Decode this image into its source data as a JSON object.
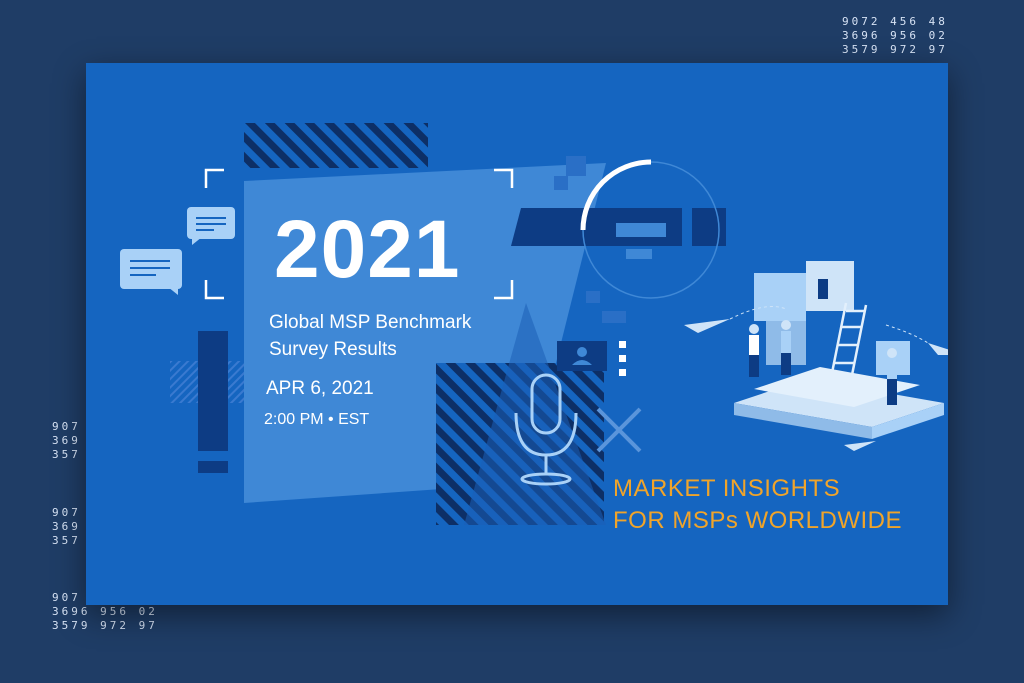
{
  "event": {
    "year": "2021",
    "title_line1": "Global MSP Benchmark",
    "title_line2": "Survey Results",
    "date": "APR 6, 2021",
    "time": "2:00 PM • EST",
    "tagline_line1": "MARKET INSIGHTS",
    "tagline_line2": "FOR MSPs WORLDWIDE"
  },
  "number_grids": {
    "full": [
      "9072 456 48",
      "3696 956 02",
      "3579 972 97"
    ],
    "partial": [
      "907",
      "369",
      "357"
    ],
    "bottom_left": [
      "907",
      "3696 956 02",
      "3579 972 97"
    ]
  },
  "colors": {
    "page_background": "#1f3d66",
    "card_background": "#1565c0",
    "panel_light": "#3f88d6",
    "accent_dark": "#0d3c84",
    "tagline": "#f0a42a",
    "icon_light": "#a9d1f7"
  },
  "icons": [
    "chat-bubble-icon",
    "exclamation-icon",
    "microphone-icon",
    "x-mark-icon",
    "user-icon",
    "loading-arc-icon",
    "paper-plane-icon"
  ]
}
